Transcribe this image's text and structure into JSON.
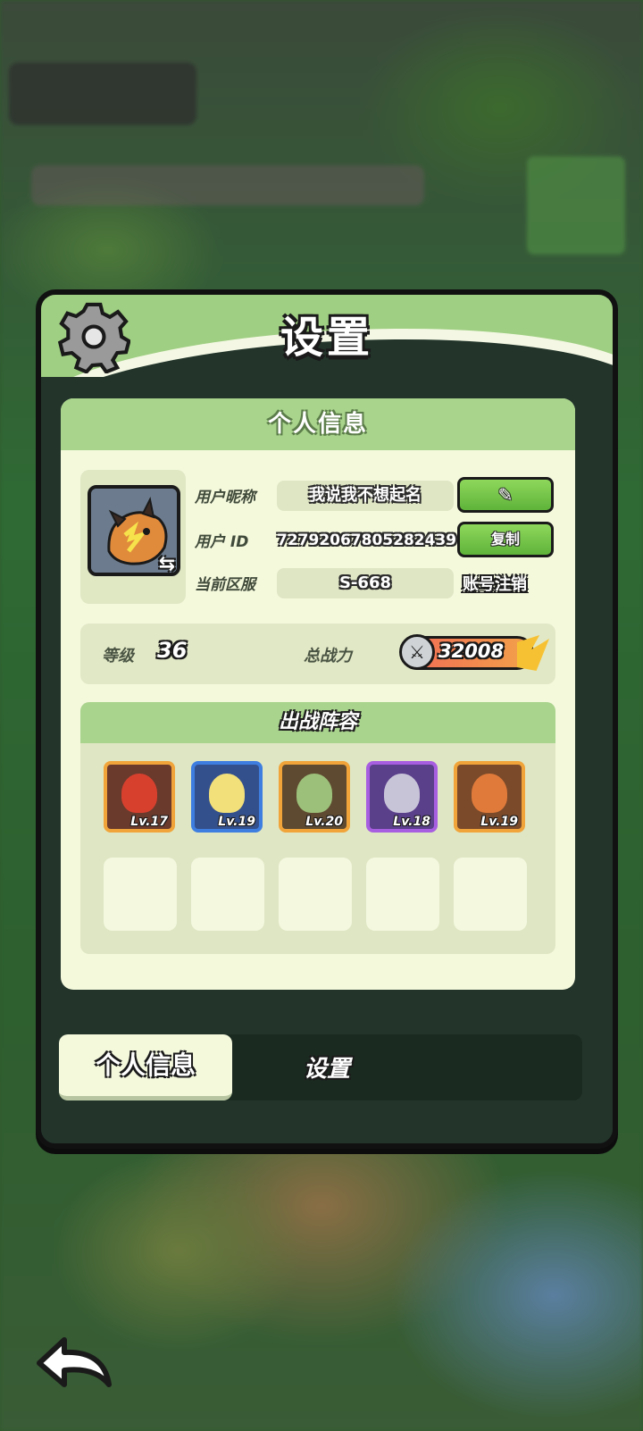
{
  "panel": {
    "title": "设置",
    "card_title": "个人信息"
  },
  "profile": {
    "nickname_label": "用户昵称",
    "nickname": "我说我不想起名",
    "id_label": "用户 ID",
    "user_id": "72792067805282439",
    "server_label": "当前区服",
    "server": "S-668",
    "copy_label": "复制",
    "cancel_account_label": "账号注销",
    "edit_icon": "pencil-icon",
    "swap_icon": "swap-icon"
  },
  "stats": {
    "level_label": "等级",
    "level": "36",
    "power_label": "总战力",
    "power": "32008"
  },
  "lineup": {
    "title": "出战阵容",
    "heroes": [
      {
        "level": "Lv.17",
        "frame": "#f0a43a",
        "bg": "#6a3a2c"
      },
      {
        "level": "Lv.19",
        "frame": "#3e7ee0",
        "bg": "#34508c"
      },
      {
        "level": "Lv.20",
        "frame": "#f0a43a",
        "bg": "#5e4a30"
      },
      {
        "level": "Lv.18",
        "frame": "#a85ee0",
        "bg": "#5a3f8a"
      },
      {
        "level": "Lv.19",
        "frame": "#f0a43a",
        "bg": "#7a4a2a"
      }
    ]
  },
  "tabs": {
    "active": "个人信息",
    "inactive": "设置"
  },
  "colors": {
    "panel_bg": "#23352b",
    "card_bg": "#f4f9dc",
    "header_green": "#9fcf82",
    "button_green": "#6cc043"
  }
}
